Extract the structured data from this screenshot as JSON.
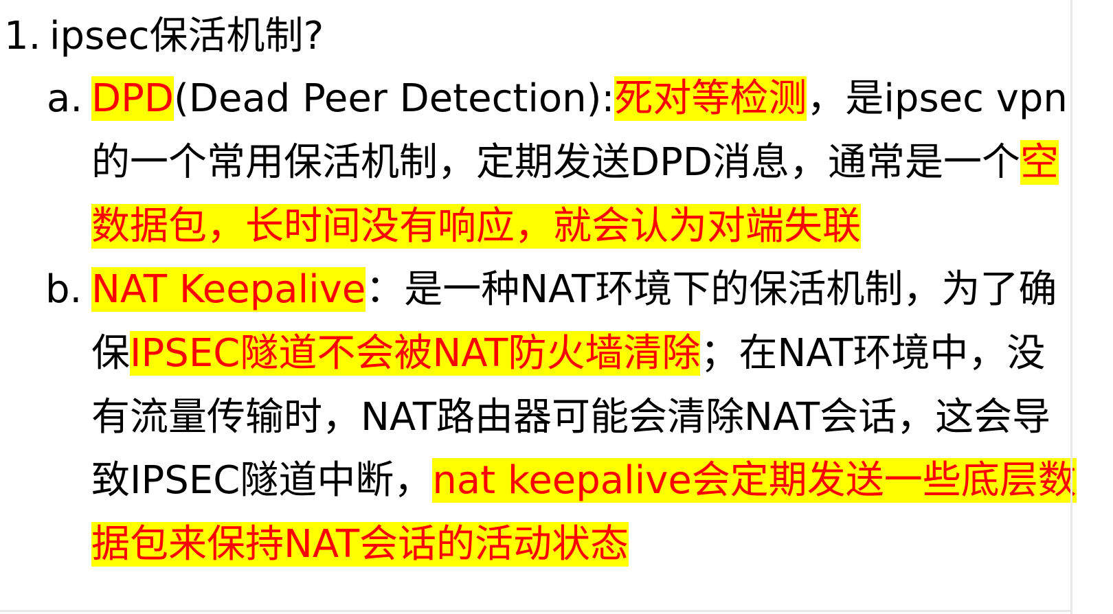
{
  "heading": {
    "number": "1.",
    "text": "ipsec保活机制?"
  },
  "item_a": {
    "marker": "a.",
    "line1": {
      "term": "DPD",
      "expansion": "(Dead Peer Detection):",
      "meaning": "死对等检测",
      "rest": "，是ipsec vpn"
    },
    "line2": {
      "text": "的一个常用保活机制，定期发送DPD消息，通常是一个",
      "highlight": "空"
    },
    "line3": {
      "highlight": "数据包，长时间没有响应，就会认为对端失联"
    }
  },
  "item_b": {
    "marker": "b.",
    "line1": {
      "term": "NAT Keepalive",
      "rest": "：是一种NAT环境下的保活机制，为了确"
    },
    "line2": {
      "prefix": "保",
      "highlight": "IPSEC隧道不会被NAT防火墙清除",
      "rest": "；在NAT环境中，没"
    },
    "line3": {
      "text": "有流量传输时，NAT路由器可能会清除NAT会话，这会导"
    },
    "line4": {
      "text": "致IPSEC隧道中断，",
      "highlight": "nat keepalive会定期发送一些底层数"
    },
    "line5": {
      "highlight": "据包来保持NAT会话的活动状态"
    }
  },
  "colors": {
    "highlight_background": "#ffff00",
    "highlight_text": "#ff0000",
    "body_text": "#000000"
  }
}
